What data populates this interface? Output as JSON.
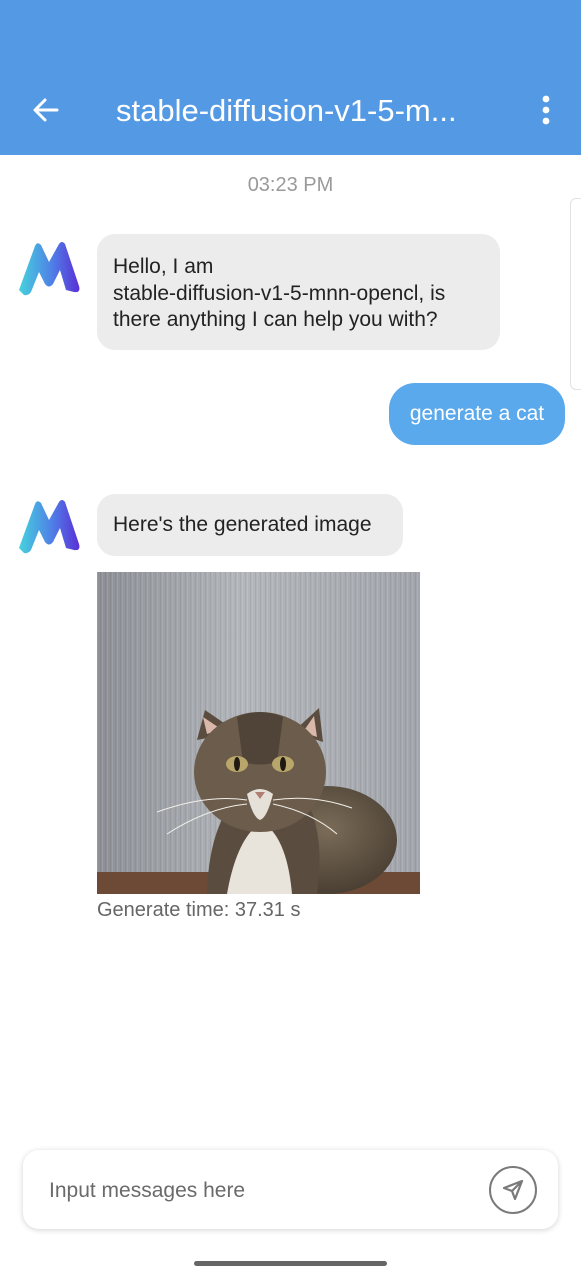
{
  "header": {
    "title": "stable-diffusion-v1-5-m...",
    "back_icon": "arrow-left-icon",
    "menu_icon": "more-vertical-icon"
  },
  "chat": {
    "timestamp": "03:23 PM",
    "messages": [
      {
        "role": "assistant",
        "lines": [
          "Hello, I am",
          "stable-diffusion-v1-5-mnn-opencl, is",
          "there anything I can help you with?"
        ]
      },
      {
        "role": "user",
        "text": "generate a cat"
      },
      {
        "role": "assistant",
        "text": "Here's the generated image",
        "image": "cat-photo",
        "generate_time": "Generate time: 37.31 s"
      }
    ]
  },
  "input": {
    "placeholder": "Input messages here",
    "value": "",
    "send_icon": "send-icon"
  },
  "colors": {
    "appbar": "#5499e3",
    "user_bubble": "#5aa9ec",
    "bot_bubble": "#ececec"
  }
}
